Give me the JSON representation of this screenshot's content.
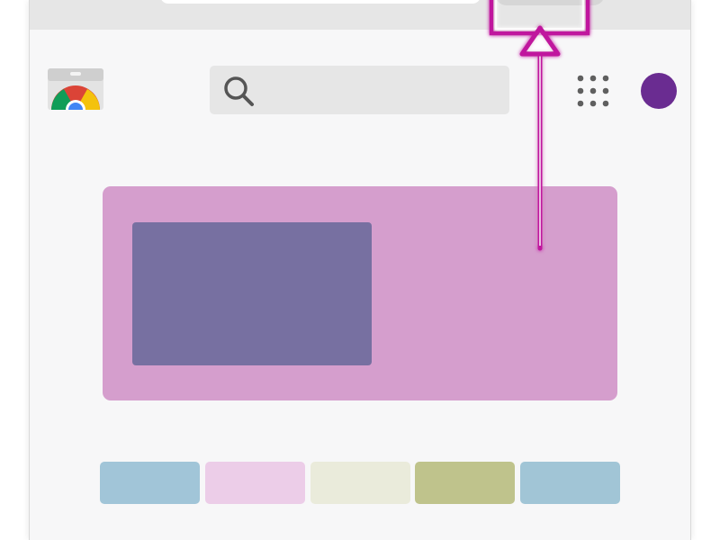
{
  "window": {
    "toolbar_color": "#e6e6e6",
    "page_color": "#f7f7f8"
  },
  "header": {
    "logo_icon": "web-store-logo-icon",
    "search": {
      "icon": "search-icon",
      "value": "",
      "placeholder": ""
    },
    "apps_icon": "apps-grid-icon",
    "avatar_color": "#6a2c91"
  },
  "hero": {
    "banner_color": "#d59ecd",
    "image_color": "#7770a1"
  },
  "swatches": [
    {
      "color": "#a1c5d8"
    },
    {
      "color": "#eccde8"
    },
    {
      "color": "#eaebdb"
    },
    {
      "color": "#bfc38c"
    },
    {
      "color": "#a1c5d6"
    }
  ],
  "annotation": {
    "color": "#c0169e",
    "icon": "arrow-up-icon"
  }
}
